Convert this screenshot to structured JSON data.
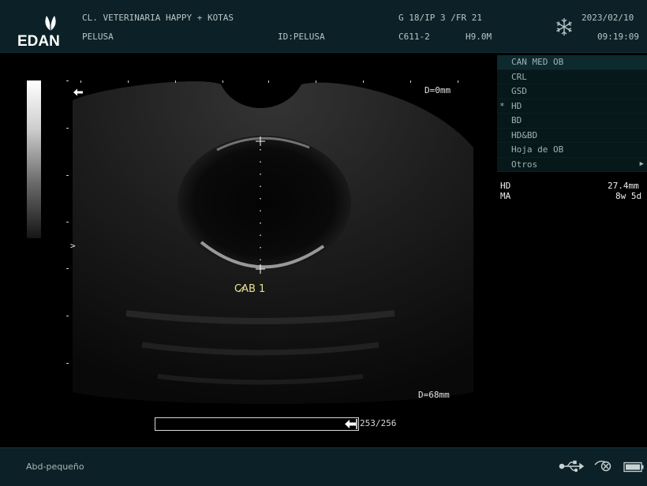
{
  "header": {
    "logo_text": "EDAN",
    "clinic": "CL. VETERINARIA HAPPY + KOTAS",
    "patient": "PELUSA",
    "patient_id": "ID:PELUSA",
    "gain_params": "G 18/IP 3 /FR 21",
    "probe": "C611-2",
    "harmonic": "H9.0M",
    "date": "2023/02/10",
    "time": "09:19:09",
    "freeze_icon": "snowflake-icon"
  },
  "image": {
    "depth_top": "D=0mm",
    "depth_bottom": "D=68mm",
    "focus_marker": ">",
    "orientation_marker": "left-arrow-icon",
    "caliper_label": "CAB 1",
    "cine_counter": "253/256",
    "cine_progress": 0.988
  },
  "menu": {
    "items": [
      {
        "label": "CAN MED OB",
        "selected": false,
        "header": true,
        "submenu": false
      },
      {
        "label": "CRL",
        "selected": false,
        "header": false,
        "submenu": false
      },
      {
        "label": "GSD",
        "selected": false,
        "header": false,
        "submenu": false
      },
      {
        "label": "HD",
        "selected": true,
        "header": false,
        "submenu": false
      },
      {
        "label": "BD",
        "selected": false,
        "header": false,
        "submenu": false
      },
      {
        "label": "HD&BD",
        "selected": false,
        "header": false,
        "submenu": false
      },
      {
        "label": "Hoja de OB",
        "selected": false,
        "header": false,
        "submenu": false
      },
      {
        "label": "Otros",
        "selected": false,
        "header": false,
        "submenu": true
      }
    ],
    "selected_marker": "*"
  },
  "measurements": [
    {
      "label": "HD",
      "value": "27.4mm"
    },
    {
      "label": "MA",
      "value": "8w 5d"
    }
  ],
  "footer": {
    "preset": "Abd-pequeño",
    "icons": [
      "usb-icon",
      "dicom-icon",
      "battery-icon"
    ]
  }
}
